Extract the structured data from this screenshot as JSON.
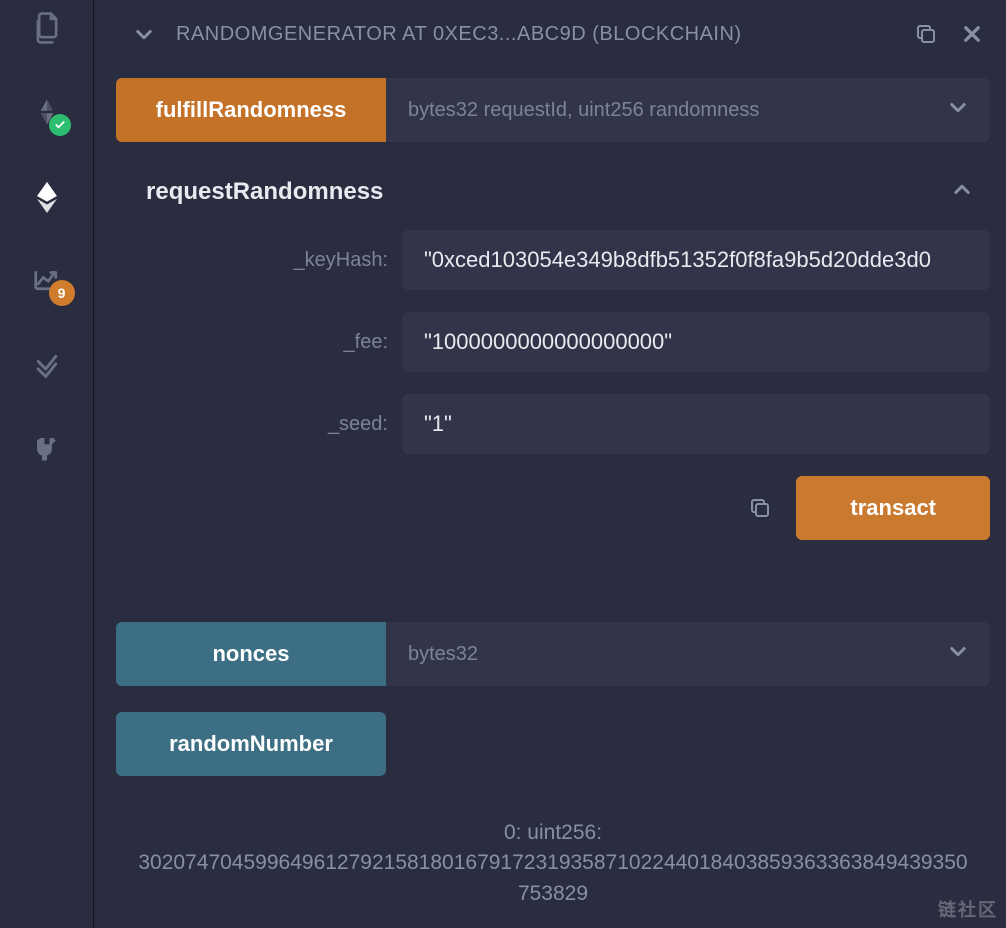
{
  "sidebar": {
    "badge_count": "9"
  },
  "header": {
    "title": "RANDOMGENERATOR AT 0XEC3...ABC9D (BLOCKCHAIN)"
  },
  "functions": {
    "fulfill": {
      "label": "fulfillRandomness",
      "args_hint": "bytes32 requestId, uint256 randomness"
    },
    "request": {
      "label": "requestRandomness",
      "params": {
        "keyHash": {
          "label": "_keyHash:",
          "value": "\"0xced103054e349b8dfb51352f0f8fa9b5d20dde3d0"
        },
        "fee": {
          "label": "_fee:",
          "value": "\"1000000000000000000\""
        },
        "seed": {
          "label": "_seed:",
          "value": "\"1\""
        }
      },
      "transact_label": "transact"
    },
    "nonces": {
      "label": "nonces",
      "args_hint": "bytes32"
    },
    "randomNumber": {
      "label": "randomNumber"
    }
  },
  "output": {
    "line1": "0: uint256:",
    "line2": "30207470459964961279215818016791723193587102244018403859363363849439350753829"
  },
  "watermark": "链社区"
}
